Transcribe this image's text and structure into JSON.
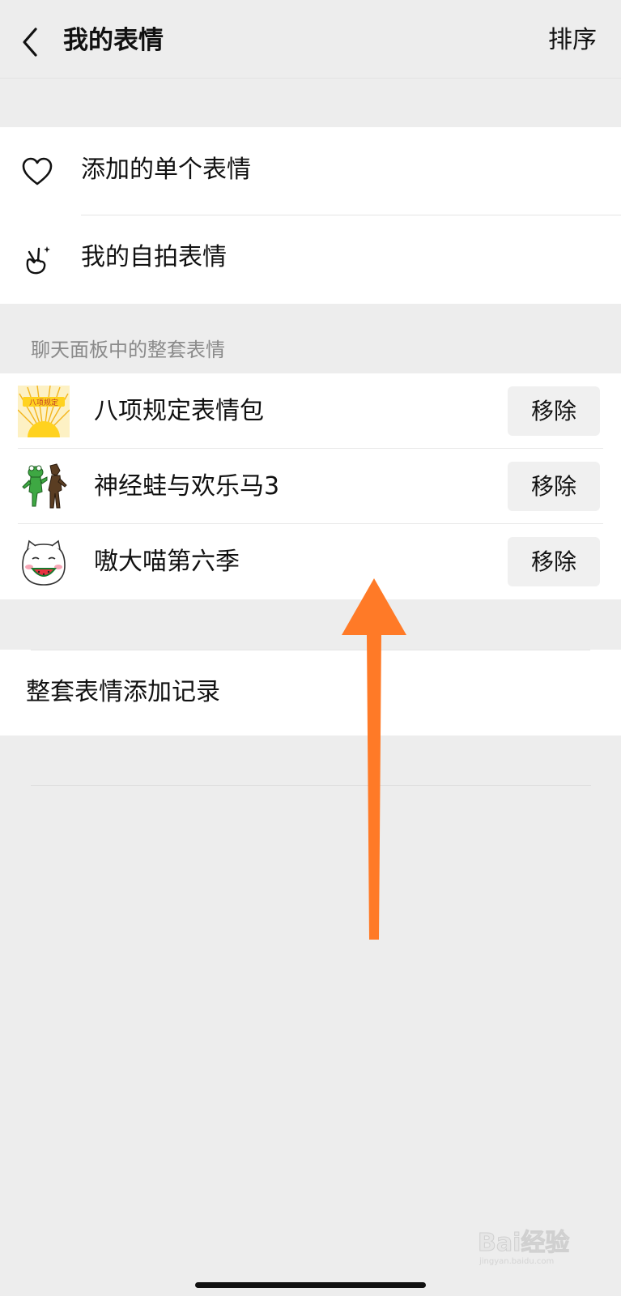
{
  "navbar": {
    "title": "我的表情",
    "sort_label": "排序"
  },
  "single_section": {
    "items": [
      {
        "label": "添加的单个表情",
        "icon": "heart-icon"
      },
      {
        "label": "我的自拍表情",
        "icon": "selfie-hand-icon"
      }
    ]
  },
  "packs_section": {
    "header": "聊天面板中的整套表情",
    "packs": [
      {
        "name": "八项规定表情包",
        "remove_label": "移除",
        "thumb_text": "八项规定"
      },
      {
        "name": "神经蛙与欢乐马3",
        "remove_label": "移除"
      },
      {
        "name": "嗷大喵第六季",
        "remove_label": "移除"
      }
    ]
  },
  "history": {
    "label": "整套表情添加记录"
  },
  "annotation": {
    "type": "up-arrow",
    "color": "#ff7a27"
  },
  "watermark": {
    "text": "Bai经验",
    "sub": "jingyan.baidu.com"
  },
  "colors": {
    "background": "#ededed",
    "card": "#ffffff",
    "button_bg": "#f0f0f0",
    "secondary_text": "#8a8a8a"
  }
}
